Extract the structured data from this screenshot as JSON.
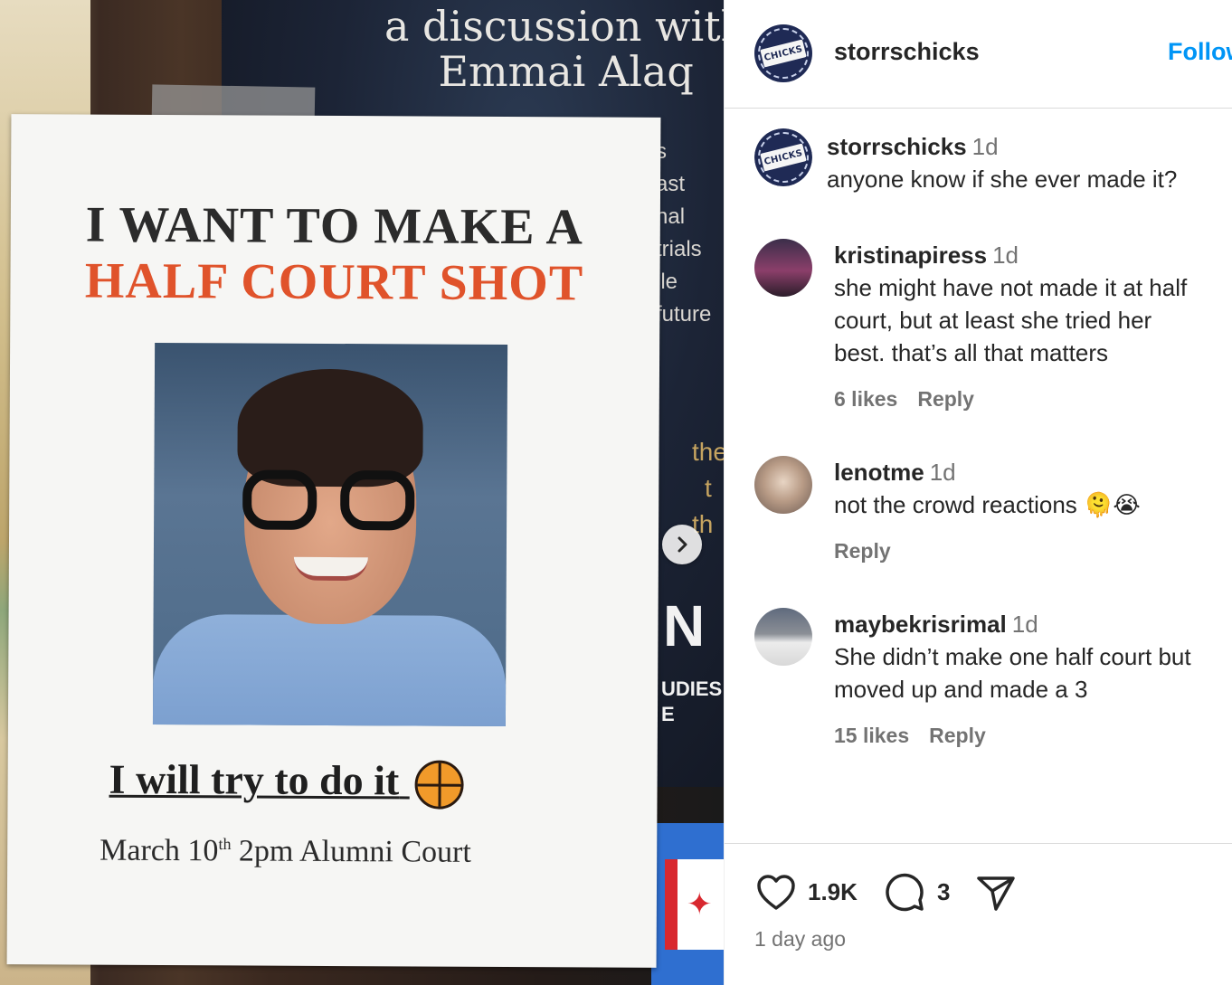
{
  "post_image": {
    "background_poster": {
      "headline_line1": "a discussion with",
      "headline_line2": "Emmai Alaq",
      "side_lines": [
        "s",
        "ast",
        "nal",
        "trials",
        "ile",
        "future"
      ],
      "gold_lines": [
        "the",
        "t",
        "th"
      ],
      "big_letters": "N",
      "footer_lines": [
        "UDIES",
        "E"
      ]
    },
    "flyer": {
      "line1": "I WANT TO MAKE A",
      "line2": "HALF COURT SHOT",
      "try_text": "I will try to do it",
      "date_prefix": "March 10",
      "date_sup": "th",
      "date_suffix": " 2pm Alumni Court"
    },
    "next_button_icon": "chevron-right-icon",
    "colors": {
      "flyer_orange": "#e0532b",
      "flyer_text": "#2b2b2b"
    }
  },
  "header": {
    "username": "storrschicks",
    "follow_label": "Follow",
    "avatar_text": "CHICKS"
  },
  "comments": [
    {
      "username": "storrschicks",
      "time": "1d",
      "lines": [
        "anyone know if she ever made it?"
      ],
      "likes": "",
      "reply": ""
    },
    {
      "username": "kristinapiress",
      "time": "1d",
      "lines": [
        "she might have not made it at half",
        "court, but at least she tried her",
        "best. that’s all that matters"
      ],
      "likes": "6 likes",
      "reply": "Reply"
    },
    {
      "username": "lenotme",
      "time": "1d",
      "lines": [
        "not the crowd reactions 🫠😭"
      ],
      "likes": "",
      "reply": "Reply"
    },
    {
      "username": "maybekrisrimal",
      "time": "1d",
      "lines": [
        "She didn’t make one half court but",
        "moved up and made a 3"
      ],
      "likes": "15 likes",
      "reply": "Reply"
    }
  ],
  "footer": {
    "likes_count": "1.9K",
    "comments_count": "3",
    "posted": "1 day ago",
    "icons": [
      "heart-icon",
      "comment-icon",
      "share-icon"
    ]
  },
  "colors": {
    "link_blue": "#0095f6",
    "text_primary": "#262626",
    "text_secondary": "#737373"
  }
}
